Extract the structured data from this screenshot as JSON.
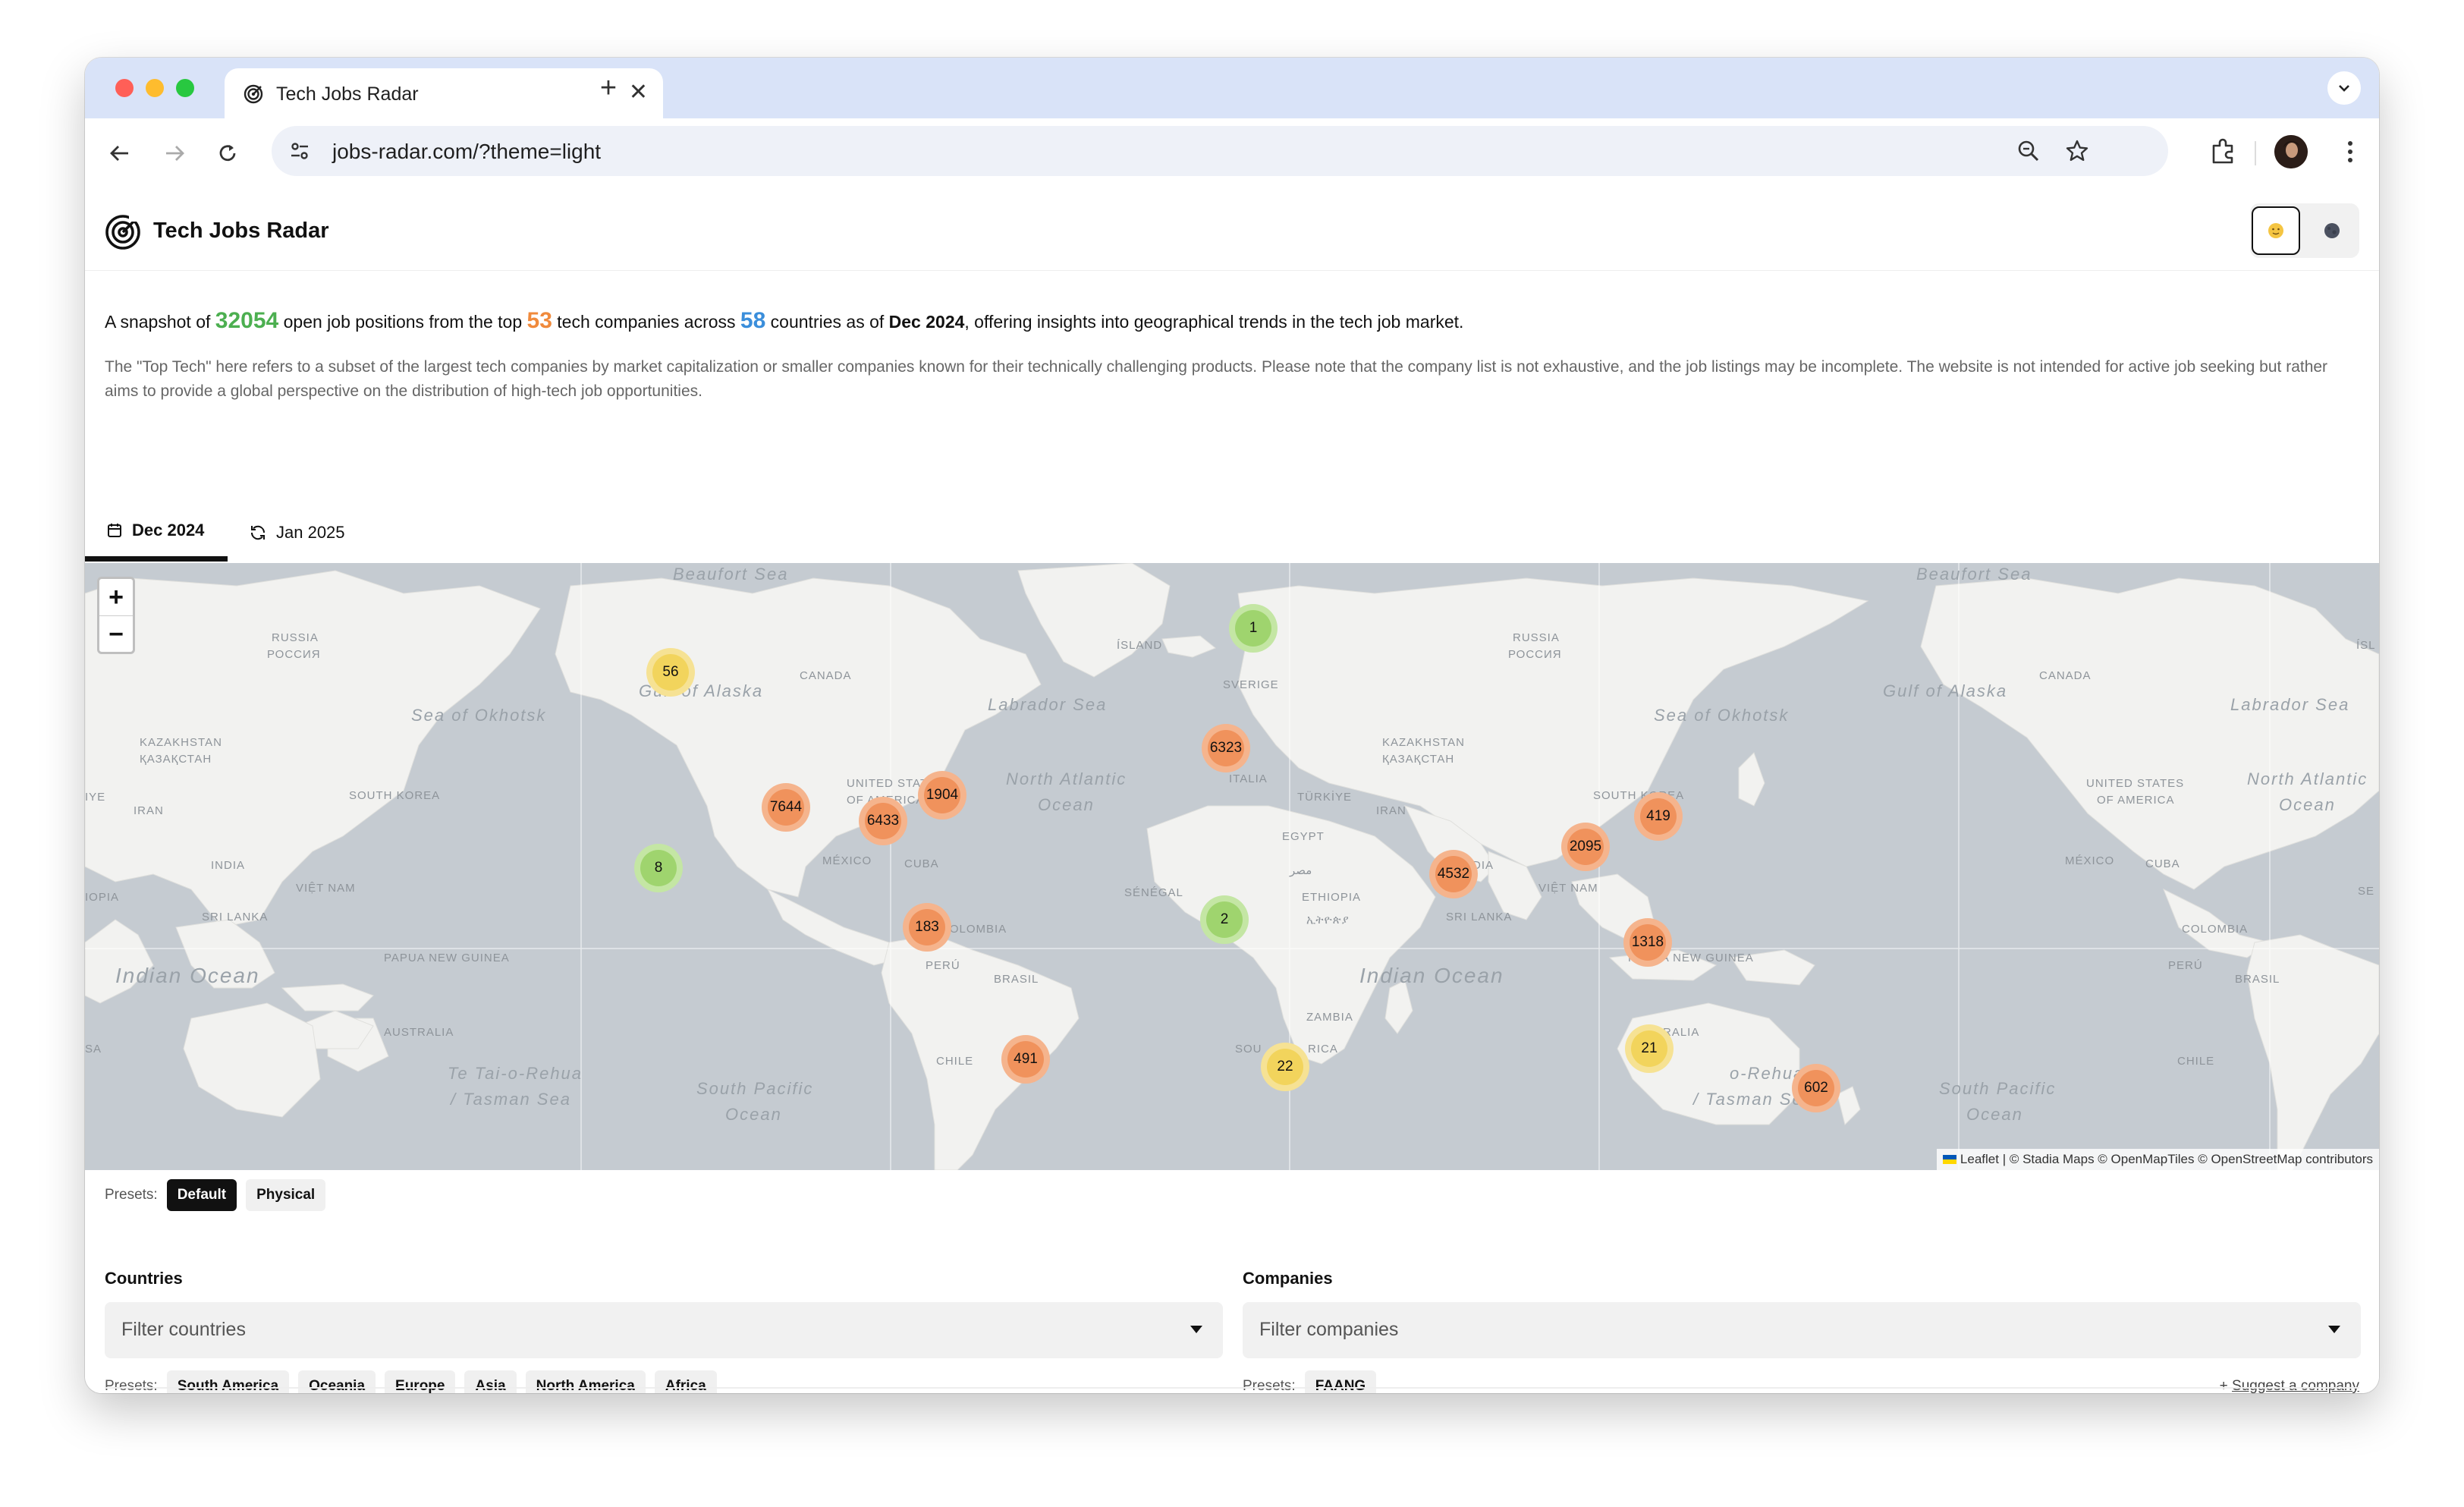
{
  "browser": {
    "tab_title": "Tech Jobs Radar",
    "tab_close": "✕",
    "new_tab": "+",
    "url": "jobs-radar.com/?theme=light"
  },
  "header": {
    "title": "Tech Jobs Radar"
  },
  "intro": {
    "prefix": "A snapshot of ",
    "positions": "32054",
    "mid1": " open job positions from the top ",
    "companies": "53",
    "mid2": " tech companies across ",
    "countries": "58",
    "mid3": " countries as of ",
    "date": "Dec 2024",
    "suffix": ", offering insights into geographical trends in the tech job market.",
    "disclaimer": "The \"Top Tech\" here refers to a subset of the largest tech companies by market capitalization or smaller companies known for their technically challenging products. Please note that the company list is not exhaustive, and the job listings may be incomplete. The website is not intended for active job seeking but rather aims to provide a global perspective on the distribution of high-tech job opportunities."
  },
  "date_tabs": [
    {
      "label": "Dec 2024",
      "active": true
    },
    {
      "label": "Jan 2025",
      "active": false
    }
  ],
  "map": {
    "zoom_in": "+",
    "zoom_out": "−",
    "attribution_leaflet": "Leaflet",
    "attribution_rest": " | © Stadia Maps © OpenMapTiles © OpenStreetMap contributors",
    "clusters": [
      {
        "count": "56",
        "level": "yellow"
      },
      {
        "count": "1",
        "level": "green"
      },
      {
        "count": "6323",
        "level": "orange"
      },
      {
        "count": "7644",
        "level": "orange"
      },
      {
        "count": "1904",
        "level": "orange"
      },
      {
        "count": "6433",
        "level": "orange"
      },
      {
        "count": "8",
        "level": "green"
      },
      {
        "count": "183",
        "level": "orange"
      },
      {
        "count": "2",
        "level": "green"
      },
      {
        "count": "491",
        "level": "orange"
      },
      {
        "count": "22",
        "level": "yellow"
      },
      {
        "count": "4532",
        "level": "orange"
      },
      {
        "count": "2095",
        "level": "orange"
      },
      {
        "count": "419",
        "level": "orange"
      },
      {
        "count": "1318",
        "level": "orange"
      },
      {
        "count": "21",
        "level": "yellow"
      },
      {
        "count": "602",
        "level": "orange"
      }
    ],
    "labels": {
      "beaufort1": "Beaufort Sea",
      "beaufort2": "Beaufort Sea",
      "russia1": "RUSSIA",
      "russia1b": "РОССИЯ",
      "russia2": "RUSSIA",
      "russia2b": "РОССИЯ",
      "alaska1": "Gulf of Alaska",
      "alaska2": "Gulf of Alaska",
      "canada1": "CANADA",
      "canada2": "CANADA",
      "labrador1": "Labrador Sea",
      "labrador2": "Labrador Sea",
      "island1": "ÍSLAND",
      "island2": "ÍSL",
      "sverige": "SVERIGE",
      "okhotsk1": "Sea of Okhotsk",
      "okhotsk2": "Sea of Okhotsk",
      "kaz1": "KAZAKHSTAN",
      "kaz1b": "ҚАЗАҚСТАН",
      "kaz2": "KAZAKHSTAN",
      "kaz2b": "ҚАЗАҚСТАН",
      "italia": "ITALIA",
      "us1": "UNITED STATES",
      "us1b": "OF AMERICA",
      "us2": "UNITED STATES",
      "us2b": "OF AMERICA",
      "natl1": "North Atlantic",
      "natl1b": "Ocean",
      "natl2": "North Atlantic",
      "natl2b": "Ocean",
      "turkiye": "TÜRKİYE",
      "iran1": "IRAN",
      "iran2": "IRAN",
      "southkorea1": "SOUTH KOREA",
      "southkorea2": "SOUTH KOREA",
      "egypt": "EGYPT",
      "egypt2": "مصر",
      "mexico1": "MÉXICO",
      "mexico2": "MÉXICO",
      "cuba1": "CUBA",
      "cuba2": "CUBA",
      "india1": "INDIA",
      "india2": "INDIA",
      "vietnam1": "VIỆT NAM",
      "vietnam2": "VIỆT NAM",
      "senegal": "SÉNÉGAL",
      "ethiopia": "ETHIOPIA",
      "ethiopia2": "ኢትዮጵያ",
      "ethiopia_left": "IOPIA",
      "srilanka1": "SRI LANKA",
      "srilanka2": "SRI LANKA",
      "colombia1": "COLOMBIA",
      "colombia2": "COLOMBIA",
      "indian1": "Indian Ocean",
      "indian2": "Indian Ocean",
      "png1": "PAPUA NEW GUINEA",
      "png2": "PAPUA NEW GUINEA",
      "peru1": "PERÚ",
      "peru2": "PERÚ",
      "brasil1": "BRASIL",
      "brasil2": "BRASIL",
      "australia1": "AUSTRALIA",
      "australia2": "RALIA",
      "zambia": "ZAMBIA",
      "southafrica": "SOU",
      "southafrica2": "RICA",
      "chile1": "CHILE",
      "chile2": "CHILE",
      "tasman1": "Te Tai-o-Rehua",
      "tasman1b": "/ Tasman Sea",
      "tasman2": "o-Rehua",
      "tasman2b": "/ Tasman Sea",
      "sp1": "South Pacific",
      "sp1b": "Ocean",
      "sp2": "South Pacific",
      "sp2b": "Ocean",
      "left_iye": "IYE",
      "left_sa": "SA",
      "right_se": "SE"
    }
  },
  "map_presets": {
    "label": "Presets:",
    "items": [
      {
        "label": "Default",
        "active": true
      },
      {
        "label": "Physical",
        "active": false
      }
    ]
  },
  "countries": {
    "label": "Countries",
    "placeholder": "Filter countries",
    "presets_label": "Presets:",
    "presets": [
      "South America",
      "Oceania",
      "Europe",
      "Asia",
      "North America",
      "Africa"
    ]
  },
  "companies": {
    "label": "Companies",
    "placeholder": "Filter companies",
    "presets_label": "Presets:",
    "presets": [
      "FAANG"
    ],
    "suggest_prefix": "+ ",
    "suggest_link": "Suggest a company"
  },
  "colors": {
    "orange_fill": "#f0925c",
    "orange_halo": "#f5b48d",
    "yellow_fill": "#f2d45c",
    "yellow_halo": "#f6e294",
    "green_fill": "#9fd46e",
    "green_halo": "#c4e6a4",
    "land": "#f2f2f0",
    "water": "#c5cbd1"
  }
}
